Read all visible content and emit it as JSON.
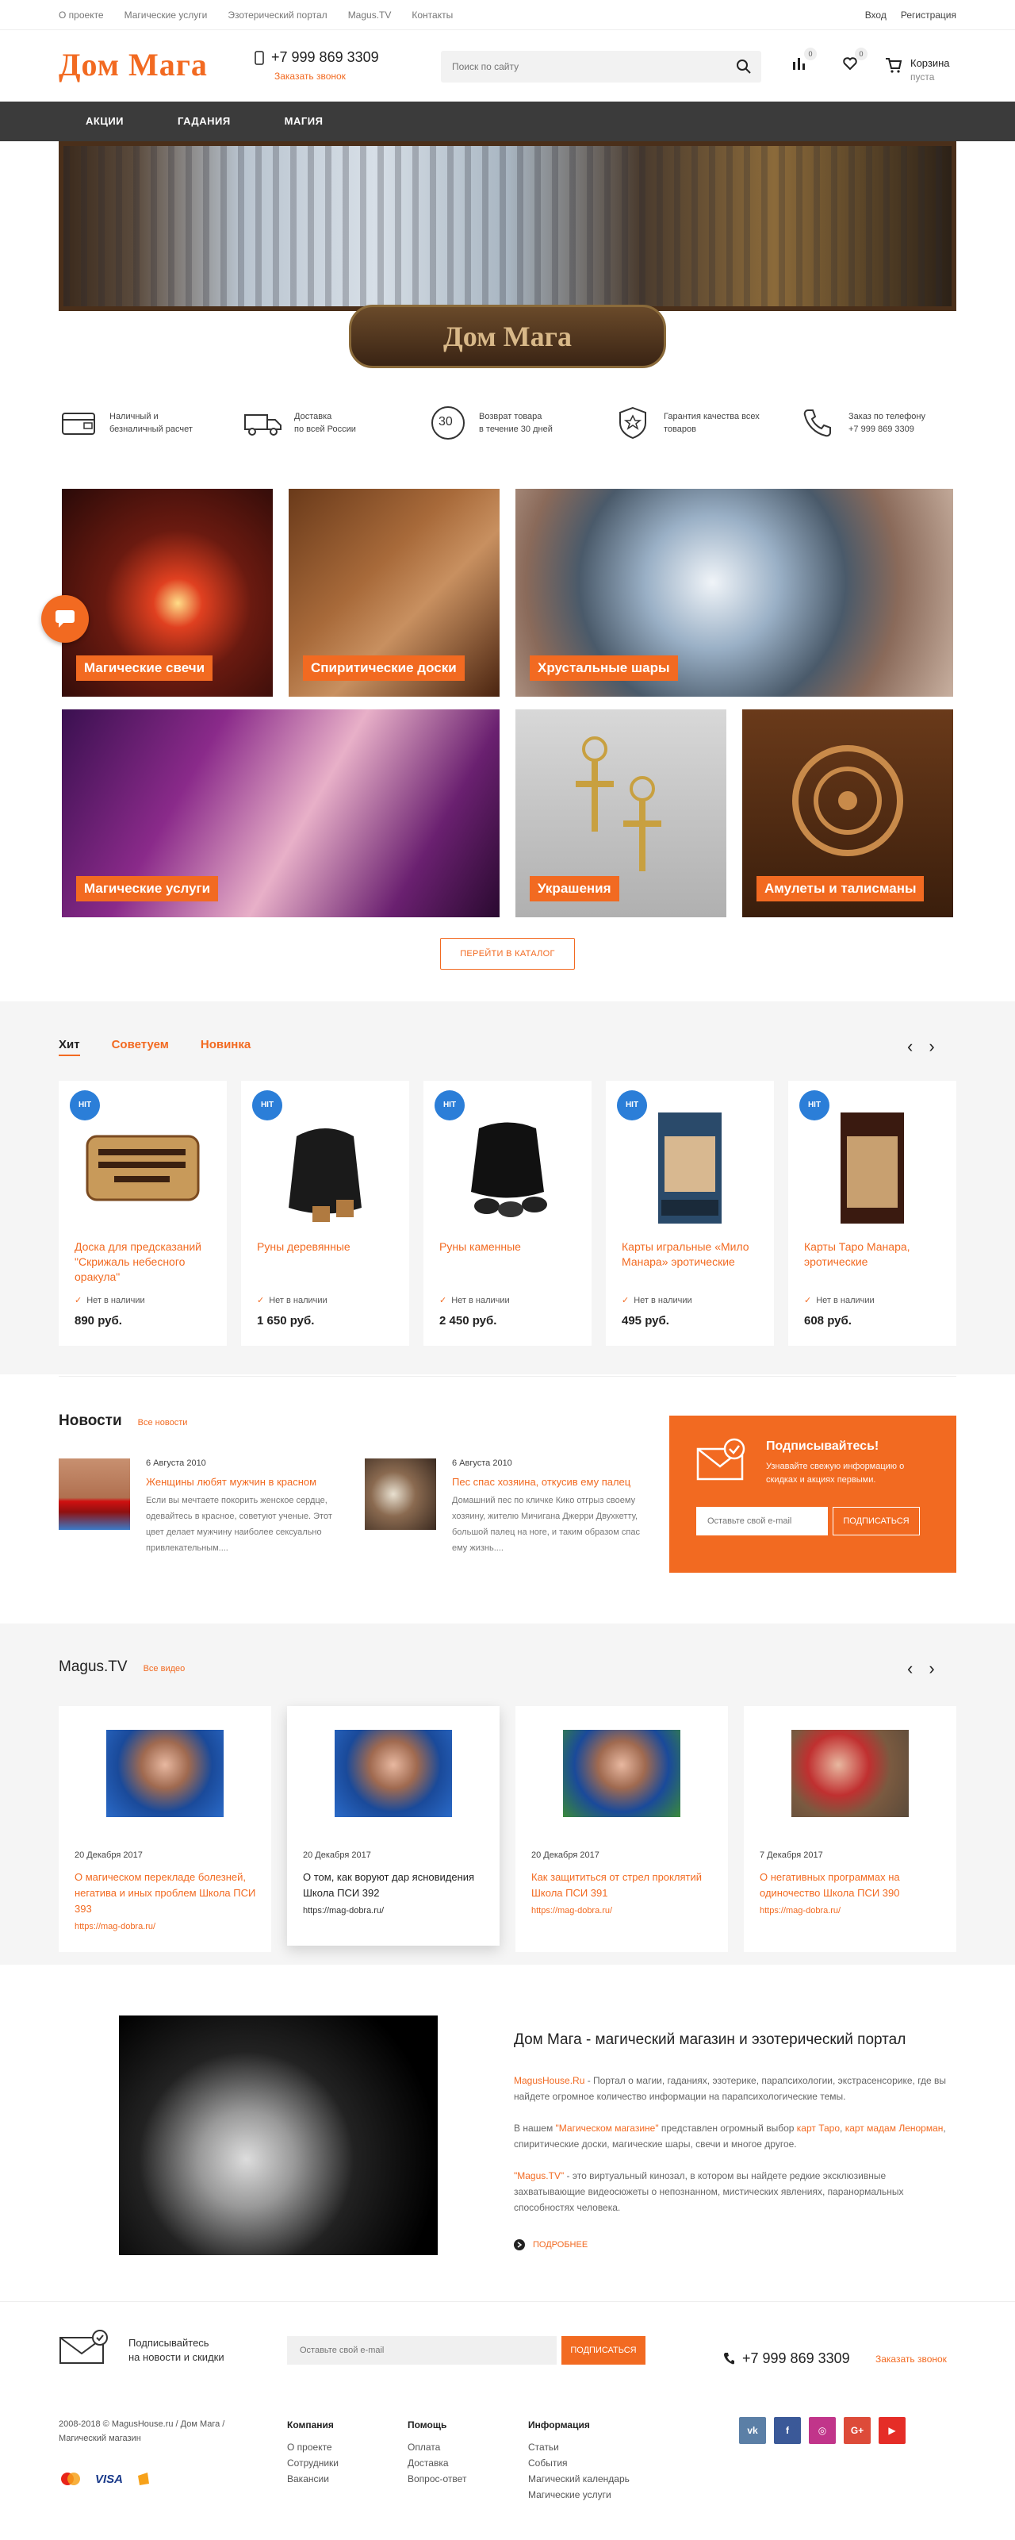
{
  "topbar": {
    "links": [
      "О проекте",
      "Магические услуги",
      "Эзотерический портал",
      "Magus.TV",
      "Контакты"
    ],
    "login": "Вход",
    "register": "Регистрация"
  },
  "header": {
    "logo": "Дом Мага",
    "phone": "+7 999 869 3309",
    "call": "Заказать звонок",
    "search_placeholder": "Поиск по сайту",
    "compare_count": "0",
    "favorites_count": "0",
    "cart_label": "Корзина",
    "cart_status": "пуста"
  },
  "nav": [
    "АКЦИИ",
    "ГАДАНИЯ",
    "МАГИЯ"
  ],
  "banner": {
    "plate": "Дом Мага"
  },
  "features": [
    {
      "icon": "wallet-icon",
      "text": "Наличный и\nбезналичный расчет"
    },
    {
      "icon": "truck-icon",
      "text": "Доставка\nпо всей России"
    },
    {
      "icon": "return-icon",
      "text": "Возврат товара\nв течение 30 дней",
      "badge": "30"
    },
    {
      "icon": "quality-icon",
      "text": "Гарантия качества всех\nтоваров"
    },
    {
      "icon": "phone-icon",
      "text": "Заказ по телефону\n+7 999 869 3309"
    }
  ],
  "categories": [
    "Магические свечи",
    "Спиритические доски",
    "Хрустальные шары",
    "Магические услуги",
    "Украшения",
    "Амулеты и талисманы"
  ],
  "catalog_button": "ПЕРЕЙТИ В КАТАЛОГ",
  "products": {
    "tabs": [
      "Хит",
      "Советуем",
      "Новинка"
    ],
    "badge": "HIT",
    "items": [
      {
        "name": "Доска для предсказаний \"Скрижаль небесного оракула\"",
        "status": "Нет в наличии",
        "price": "890 руб."
      },
      {
        "name": "Руны деревянные",
        "status": "Нет в наличии",
        "price": "1 650 руб."
      },
      {
        "name": "Руны каменные",
        "status": "Нет в наличии",
        "price": "2 450 руб."
      },
      {
        "name": "Карты игральные «Мило Манара» эротические",
        "status": "Нет в наличии",
        "price": "495 руб."
      },
      {
        "name": "Карты Таро Манара, эротические",
        "status": "Нет в наличии",
        "price": "608 руб."
      }
    ]
  },
  "news": {
    "title": "Новости",
    "all": "Все новости",
    "items": [
      {
        "date": "6 Августа 2010",
        "title": "Женщины любят мужчин в красном",
        "text": "Если вы мечтаете покорить женское сердце, одевайтесь в красное, советуют ученые. Этот цвет делает мужчину наиболее сексуально привлекательным...."
      },
      {
        "date": "6 Августа 2010",
        "title": "Пес спас хозяина, откусив ему палец",
        "text": "Домашний пес по кличке Кико отгрыз своему хозяину, жителю Мичигана Джерри Двухкетту, большой палец на ноге, и таким образом спас ему жизнь...."
      }
    ]
  },
  "subscribe": {
    "title": "Подписывайтесь!",
    "desc": "Узнавайте свежую информацию о скидках и акциях первыми.",
    "placeholder": "Оставьте свой e-mail",
    "button": "ПОДПИСАТЬСЯ"
  },
  "video": {
    "title": "Magus.TV",
    "all": "Все видео",
    "items": [
      {
        "date": "20 Декабря 2017",
        "title": "О магическом перекладе болезней, негатива и иных проблем Школа ПСИ 393",
        "url": "https://mag-dobra.ru/"
      },
      {
        "date": "20 Декабря 2017",
        "title": "О том, как воруют дар ясновидения Школа ПСИ 392",
        "url": "https://mag-dobra.ru/"
      },
      {
        "date": "20 Декабря 2017",
        "title": "Как защититься от стрел проклятий Школа ПСИ 391",
        "url": "https://mag-dobra.ru/"
      },
      {
        "date": "7 Декабря 2017",
        "title": "О негативных программах на одиночество Школа ПСИ 390",
        "url": "https://mag-dobra.ru/"
      }
    ]
  },
  "about": {
    "title": "Дом Мага - магический магазин и эзотерический портал",
    "p1_link": "MagusHouse.Ru",
    "p1": " - Портал о магии, гаданиях, эзотерике, парапсихологии, экстрасенсорике, где вы найдете огромное количество информации на парапсихологические темы.",
    "p2_a": "В нашем ",
    "p2_link": "\"Магическом магазине\"",
    "p2_b": " представлен огромный выбор ",
    "p2_link2": "карт Таро",
    "p2_c": ", ",
    "p2_link3": "карт мадам Ленорман",
    "p2_d": ", спиритические доски, магические шары, свечи и многое другое.",
    "p3_link": "\"Magus.TV\"",
    "p3": " - это виртуальный кинозал, в котором вы найдете редкие эксклюзивные захватывающие видеосюжеты о непознанном, мистических явлениях, паранормальных способностях человека.",
    "more": "ПОДРОБНЕЕ"
  },
  "footer": {
    "subscribe_text": "Подписывайтесь\nна новости и скидки",
    "placeholder": "Оставьте свой e-mail",
    "button": "ПОДПИСАТЬСЯ",
    "phone": "+7 999 869 3309",
    "call": "Заказать звонок",
    "copyright": "2008-2018 © MagusHouse.ru / Дом Мага / Магический магазин",
    "payments": [
      "VISA"
    ],
    "columns": [
      {
        "title": "Компания",
        "links": [
          "О проекте",
          "Сотрудники",
          "Вакансии"
        ]
      },
      {
        "title": "Помощь",
        "links": [
          "Оплата",
          "Доставка",
          "Вопрос-ответ"
        ]
      },
      {
        "title": "Информация",
        "links": [
          "Статьи",
          "События",
          "Магический календарь",
          "Магические услуги"
        ]
      }
    ],
    "social": [
      {
        "name": "vk",
        "label": "vk",
        "color": "#5b7fa6"
      },
      {
        "name": "facebook",
        "label": "f",
        "color": "#3b5998"
      },
      {
        "name": "instagram",
        "label": "◎",
        "color": "#c1358a"
      },
      {
        "name": "google-plus",
        "label": "G+",
        "color": "#dd4b39"
      },
      {
        "name": "youtube",
        "label": "▶",
        "color": "#e52d27"
      }
    ]
  },
  "colors": {
    "accent": "#f26a21",
    "nav": "#3b3b3b",
    "hit_badge": "#2b7ed8"
  }
}
